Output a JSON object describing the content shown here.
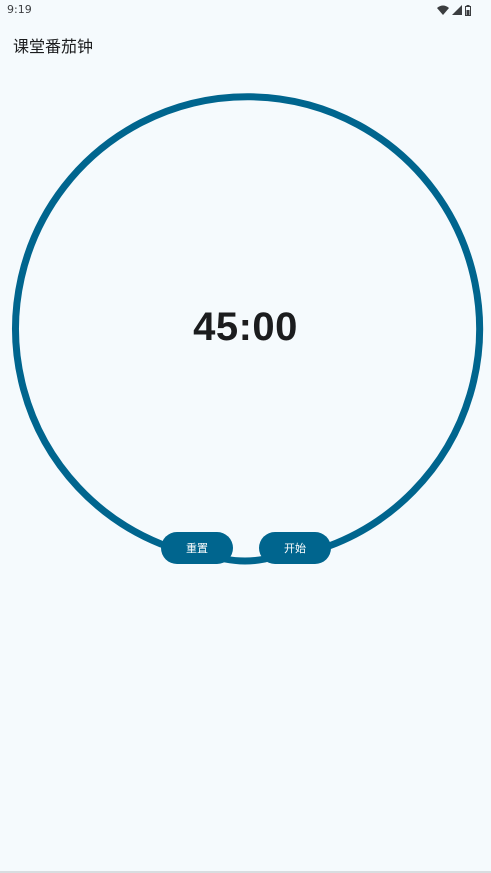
{
  "status_bar": {
    "time": "9:19",
    "icons": [
      "wifi-icon",
      "signal-icon",
      "battery-icon"
    ]
  },
  "app": {
    "title": "课堂番茄钟"
  },
  "timer": {
    "display": "45:00",
    "progress": 1.0
  },
  "controls": {
    "reset_label": "重置",
    "start_label": "开始"
  },
  "colors": {
    "background": "#f5fafd",
    "accent": "#00658e",
    "text": "#1b1c1e"
  }
}
